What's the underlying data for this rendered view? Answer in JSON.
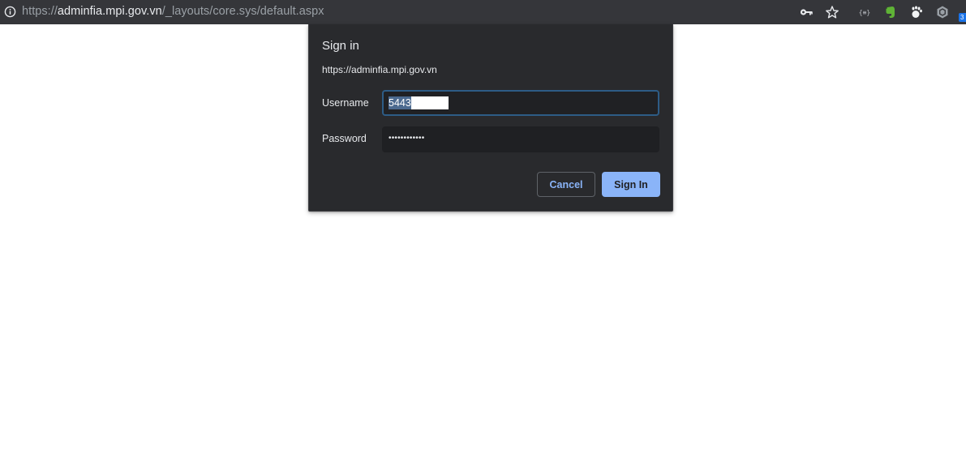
{
  "browser": {
    "url_scheme": "https://",
    "url_host": "adminfia.mpi.gov.vn",
    "url_path": "/_layouts/core.sys/default.aspx",
    "icons": [
      "info-icon",
      "key-icon",
      "star-icon",
      "extension-icon",
      "evernote-icon",
      "gnome-foot-icon",
      "hexagon-extension-icon"
    ],
    "badge": "3"
  },
  "dialog": {
    "title": "Sign in",
    "origin": "https://adminfia.mpi.gov.vn",
    "username_label": "Username",
    "username_value": "5443",
    "password_label": "Password",
    "password_mask": "••••••••••••",
    "cancel_label": "Cancel",
    "signin_label": "Sign In"
  },
  "colors": {
    "toolbar": "#35363a",
    "dialog_bg": "#292a2d",
    "accent": "#8ab4f8"
  }
}
